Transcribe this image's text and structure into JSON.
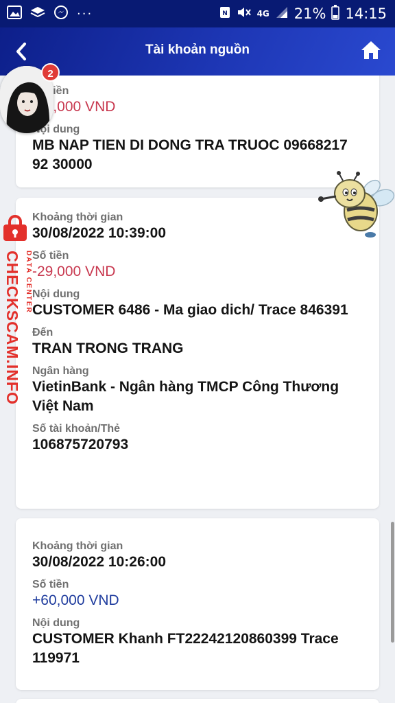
{
  "status_bar": {
    "dots": "···",
    "network": "4G",
    "battery": "21%",
    "time": "14:15"
  },
  "header": {
    "back_icon": "chevron-left-icon",
    "title": "Tài khoản nguồn",
    "home_icon": "home-icon"
  },
  "chat_head": {
    "badge_count": "2"
  },
  "watermark": {
    "text": "CHECKSCAM.INFO",
    "subtext": "DATA CENTER"
  },
  "transactions": [
    {
      "amount_label": "Số tiền",
      "amount": "-30,000 VND",
      "content_label": "Nội dung",
      "content": "MB NAP TIEN DI DONG TRA TRUOC 09668217 92 30000"
    },
    {
      "time_label": "Khoảng thời gian",
      "time": "30/08/2022 10:39:00",
      "amount_label": "Số tiền",
      "amount": "-29,000 VND",
      "content_label": "Nội dung",
      "content": "CUSTOMER 6486 - Ma giao dich/ Trace 846391",
      "to_label": "Đến",
      "to": "TRAN TRONG TRANG",
      "bank_label": "Ngân hàng",
      "bank": "VietinBank - Ngân hàng TMCP Công Thương Việt Nam",
      "account_label": "Số tài khoản/Thẻ",
      "account": "106875720793"
    },
    {
      "time_label": "Khoảng thời gian",
      "time": "30/08/2022 10:26:00",
      "amount_label": "Số tiền",
      "amount": "+60,000 VND",
      "content_label": "Nội dung",
      "content": "CUSTOMER Khanh FT22242120860399 Trace 119971"
    }
  ],
  "colors": {
    "header_bg": "#1d36b4",
    "negative": "#c8384f",
    "positive": "#1f3c9e",
    "watermark": "#e3302b"
  }
}
